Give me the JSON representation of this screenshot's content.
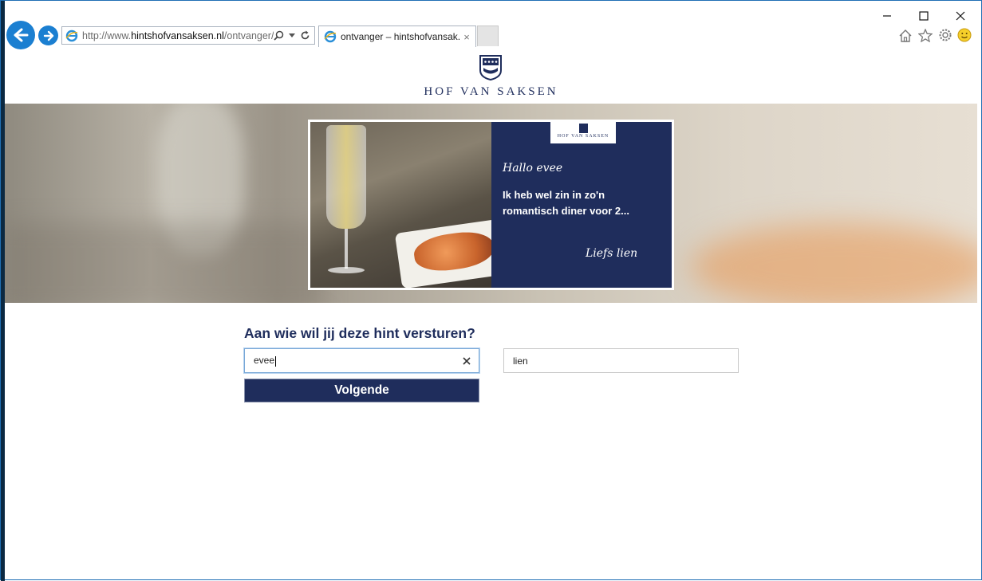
{
  "browser": {
    "address": {
      "prefix": "http://www.",
      "domain": "hintshofvansaksen.nl",
      "path": "/ontvanger/"
    },
    "tab": {
      "title": "ontvanger – hintshofvansak...",
      "close": "×"
    },
    "window_controls": {
      "minimize": "—",
      "maximize": "☐",
      "close": "✕"
    },
    "accent": "#1b7fd1"
  },
  "page": {
    "brand": "HOF VAN SAKSEN",
    "card": {
      "mini_brand": "HOF VAN SAKSEN",
      "greeting": "Hallo evee",
      "message": "Ik heb wel zin in zo'n romantisch diner voor 2...",
      "signature": "Liefs lien"
    },
    "form": {
      "question": "Aan wie wil jij deze hint versturen?",
      "recipient_value": "evee",
      "sender_value": "lien",
      "submit_label": "Volgende"
    },
    "brand_color": "#1f2d5c"
  }
}
